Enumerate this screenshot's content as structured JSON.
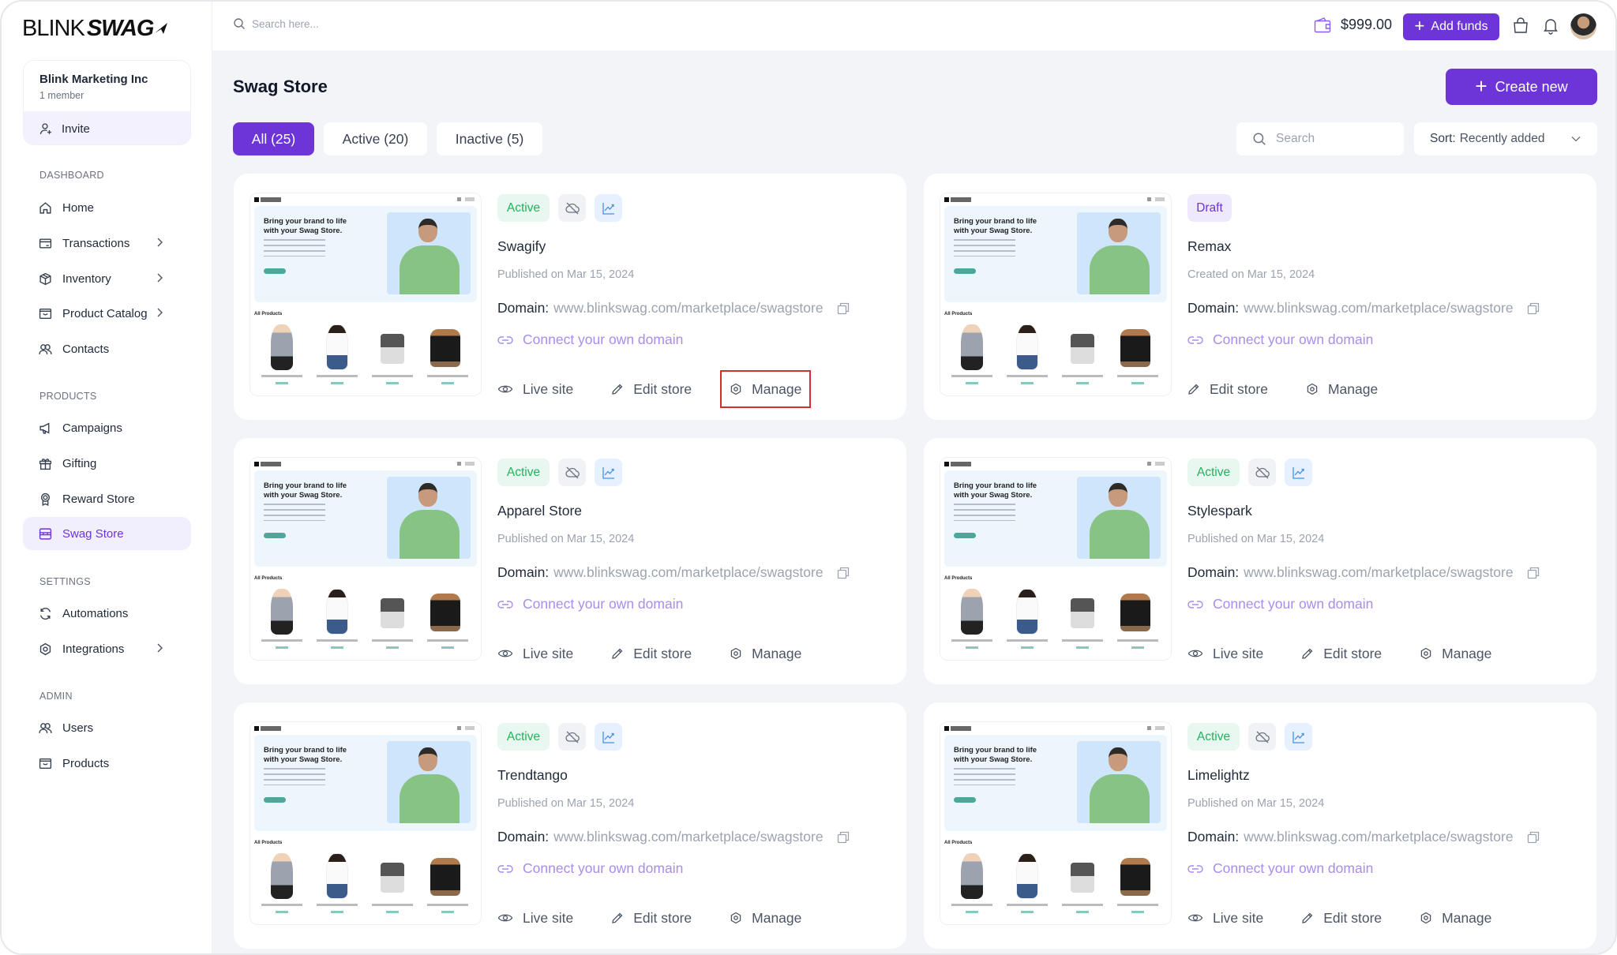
{
  "app": {
    "brand_left": "BLINK",
    "brand_right": "SWAG"
  },
  "org": {
    "name": "Blink Marketing Inc",
    "members": "1 member",
    "invite_label": "Invite"
  },
  "sidebar": {
    "sections": [
      {
        "title": "DASHBOARD",
        "items": [
          {
            "label": "Home",
            "icon": "home-icon",
            "chevron": false
          },
          {
            "label": "Transactions",
            "icon": "credit-card-icon",
            "chevron": true
          },
          {
            "label": "Inventory",
            "icon": "package-icon",
            "chevron": true
          },
          {
            "label": "Product Catalog",
            "icon": "catalog-icon",
            "chevron": true
          },
          {
            "label": "Contacts",
            "icon": "users-icon",
            "chevron": false
          }
        ]
      },
      {
        "title": "PRODUCTS",
        "items": [
          {
            "label": "Campaigns",
            "icon": "megaphone-icon",
            "chevron": false
          },
          {
            "label": "Gifting",
            "icon": "gift-icon",
            "chevron": false
          },
          {
            "label": "Reward Store",
            "icon": "award-icon",
            "chevron": false
          },
          {
            "label": "Swag Store",
            "icon": "store-icon",
            "chevron": false,
            "active": true
          }
        ]
      },
      {
        "title": "SETTINGS",
        "items": [
          {
            "label": "Automations",
            "icon": "refresh-icon",
            "chevron": false
          },
          {
            "label": "Integrations",
            "icon": "integrations-icon",
            "chevron": true
          }
        ]
      },
      {
        "title": "ADMIN",
        "items": [
          {
            "label": "Users",
            "icon": "users-icon",
            "chevron": false
          },
          {
            "label": "Products",
            "icon": "catalog-icon",
            "chevron": false
          }
        ]
      }
    ]
  },
  "topbar": {
    "search_placeholder": "Search here...",
    "balance": "$999.00",
    "add_funds_label": "Add funds"
  },
  "page": {
    "title": "Swag Store",
    "create_label": "Create new",
    "tabs": [
      {
        "label": "All (25)",
        "active": true
      },
      {
        "label": "Active (20)",
        "active": false
      },
      {
        "label": "Inactive (5)",
        "active": false
      }
    ],
    "search_placeholder": "Search",
    "sort_label": "Sort:",
    "sort_value": "Recently added"
  },
  "labels": {
    "domain": "Domain:",
    "connect": "Connect your own domain",
    "live_site": "Live site",
    "edit_store": "Edit store",
    "manage": "Manage"
  },
  "preview": {
    "headline": "Bring your brand to life with your Swag Store.",
    "section": "All Products"
  },
  "stores": [
    {
      "name": "Swagify",
      "status": "Active",
      "date": "Published on Mar 15, 2024",
      "domain": "www.blinkswag.com/marketplace/swagstore",
      "live": true,
      "highlight_manage": true
    },
    {
      "name": "Remax",
      "status": "Draft",
      "date": "Created on Mar 15, 2024",
      "domain": "www.blinkswag.com/marketplace/swagstore",
      "live": false
    },
    {
      "name": "Apparel Store",
      "status": "Active",
      "date": "Published on Mar 15, 2024",
      "domain": "www.blinkswag.com/marketplace/swagstore",
      "live": true
    },
    {
      "name": "Stylespark",
      "status": "Active",
      "date": "Published on Mar 15, 2024",
      "domain": "www.blinkswag.com/marketplace/swagstore",
      "live": true
    },
    {
      "name": "Trendtango",
      "status": "Active",
      "date": "Published on Mar 15, 2024",
      "domain": "www.blinkswag.com/marketplace/swagstore",
      "live": true
    },
    {
      "name": "Limelightz",
      "status": "Active",
      "date": "Published on Mar 15, 2024",
      "domain": "www.blinkswag.com/marketplace/swagstore",
      "live": true
    }
  ],
  "colors": {
    "accent": "#6d35d8",
    "active_green": "#22b35c",
    "link_purple": "#a88cf0",
    "highlight_red": "#d32f2f"
  }
}
